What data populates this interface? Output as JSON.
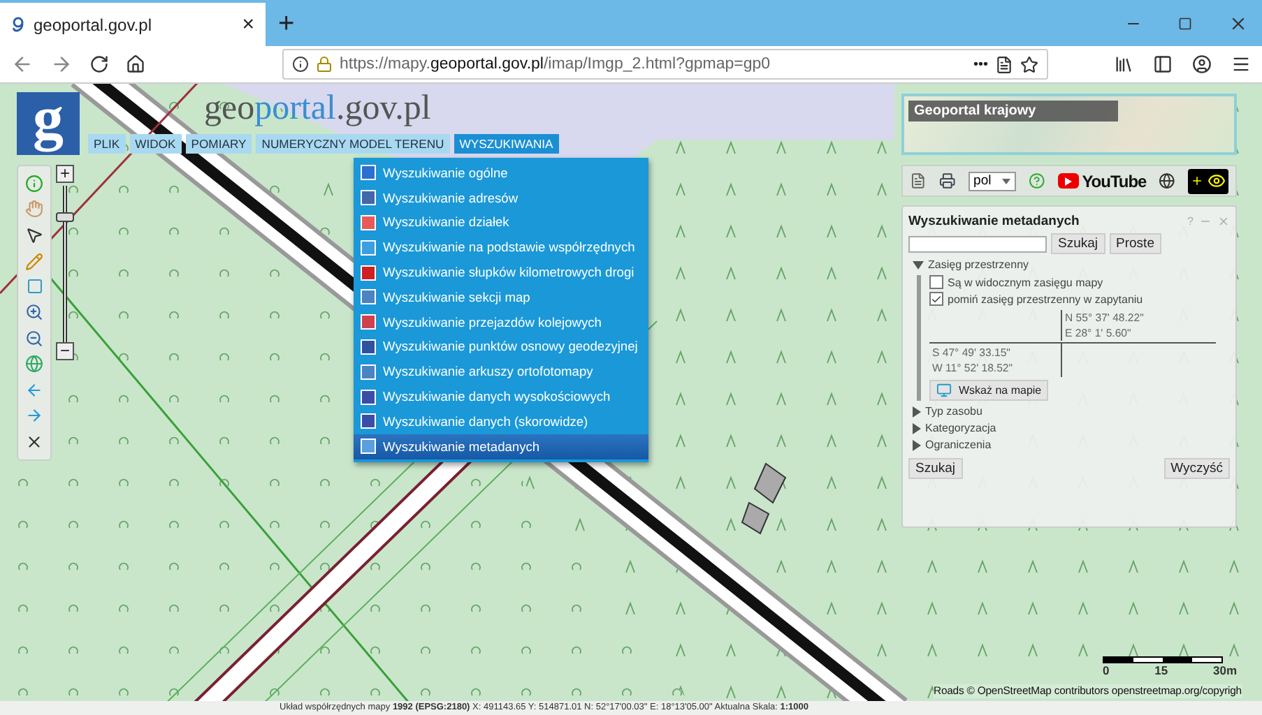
{
  "browser": {
    "tab": {
      "title": "geoportal.gov.pl",
      "close": "×"
    },
    "new_tab": "+",
    "url": {
      "prefix": "https://mapy.",
      "domain": "geoportal.gov.pl",
      "suffix": "/imap/Imgp_2.html?gpmap=gp0"
    },
    "more": "•••"
  },
  "logo": {
    "letter": "g",
    "title": [
      {
        "text": "geo",
        "kind": "plain"
      },
      {
        "text": "portal",
        "kind": "accent"
      },
      {
        "text": ".gov.pl",
        "kind": "plain"
      }
    ]
  },
  "menu": [
    {
      "label": "PLIK",
      "selected": false
    },
    {
      "label": "WIDOK",
      "selected": false
    },
    {
      "label": "POMIARY",
      "selected": false
    },
    {
      "label": "NUMERYCZNY MODEL TERENU",
      "selected": false
    },
    {
      "label": "WYSZUKIWANIA",
      "selected": true
    }
  ],
  "dropdown": [
    {
      "label": "Wyszukiwanie ogólne",
      "selected": false
    },
    {
      "label": "Wyszukiwanie adresów",
      "selected": false
    },
    {
      "label": "Wyszukiwanie działek",
      "selected": false
    },
    {
      "label": "Wyszukiwanie na podstawie współrzędnych",
      "selected": false
    },
    {
      "label": "Wyszukiwanie słupków kilometrowych drogi",
      "selected": false
    },
    {
      "label": "Wyszukiwanie sekcji map",
      "selected": false
    },
    {
      "label": "Wyszukiwanie przejazdów kolejowych",
      "selected": false
    },
    {
      "label": "Wyszukiwanie punktów osnowy geodezyjnej",
      "selected": false
    },
    {
      "label": "Wyszukiwanie arkuszy ortofotomapy",
      "selected": false
    },
    {
      "label": "Wyszukiwanie danych wysokościowych",
      "selected": false
    },
    {
      "label": "Wyszukiwanie danych (skorowidze)",
      "selected": false
    },
    {
      "label": "Wyszukiwanie metadanych",
      "selected": true
    }
  ],
  "zoom": {
    "plus": "+",
    "minus": "−",
    "level": 0.82
  },
  "overview": {
    "label": "Geoportal krajowy"
  },
  "toolbar": {
    "language": "pol",
    "youtube": "YouTube"
  },
  "panel": {
    "title": "Wyszukiwanie metadanych",
    "help": "?",
    "search_button": "Szukaj",
    "simple_button": "Proste",
    "sections": [
      {
        "label": "Zasięg przestrzenny",
        "expanded": true
      },
      {
        "label": "Typ zasobu",
        "expanded": false
      },
      {
        "label": "Kategoryzacja",
        "expanded": false
      },
      {
        "label": "Ograniczenia",
        "expanded": false
      }
    ],
    "options": [
      {
        "label": "Są w widocznym zasięgu mapy",
        "checked": false
      },
      {
        "label": "pomiń zasięg przestrzenny w zapytaniu",
        "checked": true
      }
    ],
    "coords": {
      "north": "N 55° 37' 48.22\"",
      "east": "E 28° 1' 5.60\"",
      "south": "S 47° 49' 33.15\"",
      "west": "W 11° 52' 18.52\""
    },
    "map_button": "Wskaż na mapie",
    "submit": "Szukaj",
    "clear": "Wyczyść"
  },
  "scale": {
    "ticks": [
      "0",
      "15",
      "30m"
    ]
  },
  "attribution": "Roads © OpenStreetMap contributors openstreetmap.org/copyrigh",
  "status": "Układ współrzędnych mapy **1992 (EPSG:2180)**   X: 491143.65  Y: 514871.01   N: 52°17'00.03\"  E: 18°13'05.00\"   Aktualna Skala: **1:1000**"
}
